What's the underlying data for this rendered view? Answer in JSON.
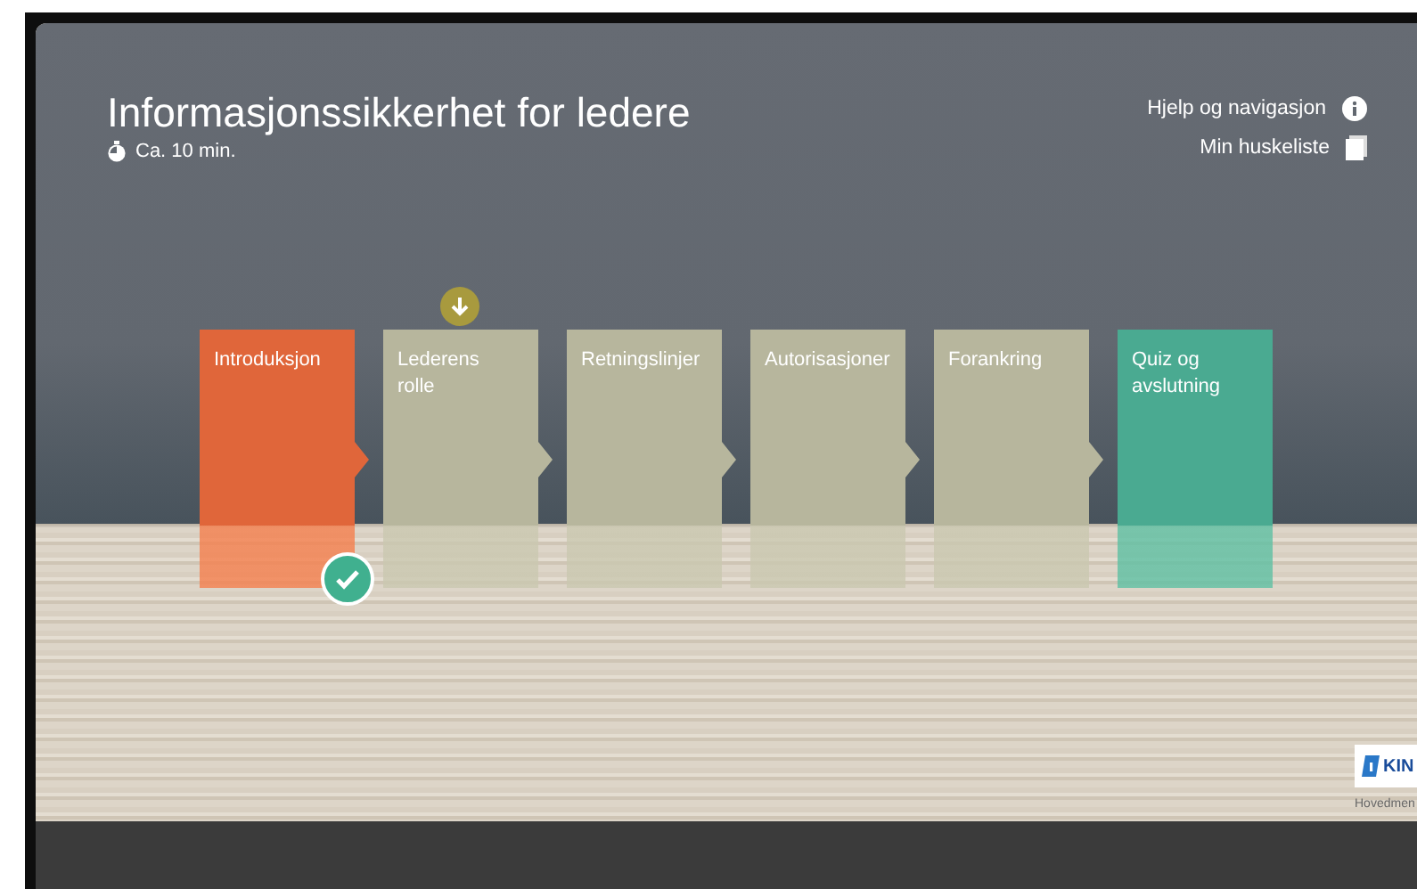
{
  "header": {
    "title": "Informasjonssikkerhet for ledere",
    "duration": "Ca. 10 min."
  },
  "links": [
    {
      "label": "Hjelp og navigasjon",
      "kind": "info"
    },
    {
      "label": "Min huskeliste",
      "kind": "list"
    }
  ],
  "modules": [
    {
      "label": "Introduksjon",
      "kind": "intro",
      "completed": true,
      "current": false
    },
    {
      "label": "Lederens\nrolle",
      "kind": "chapter",
      "completed": false,
      "current": true
    },
    {
      "label": "Retningslinjer",
      "kind": "chapter",
      "completed": false,
      "current": false
    },
    {
      "label": "Autorisasjoner",
      "kind": "chapter",
      "completed": false,
      "current": false
    },
    {
      "label": "Forankring",
      "kind": "chapter",
      "completed": false,
      "current": false
    },
    {
      "label": "Quiz og avslutning",
      "kind": "quiz",
      "completed": false,
      "current": false
    }
  ],
  "logo": {
    "text": "KIN",
    "caption": "Hovedmen"
  }
}
